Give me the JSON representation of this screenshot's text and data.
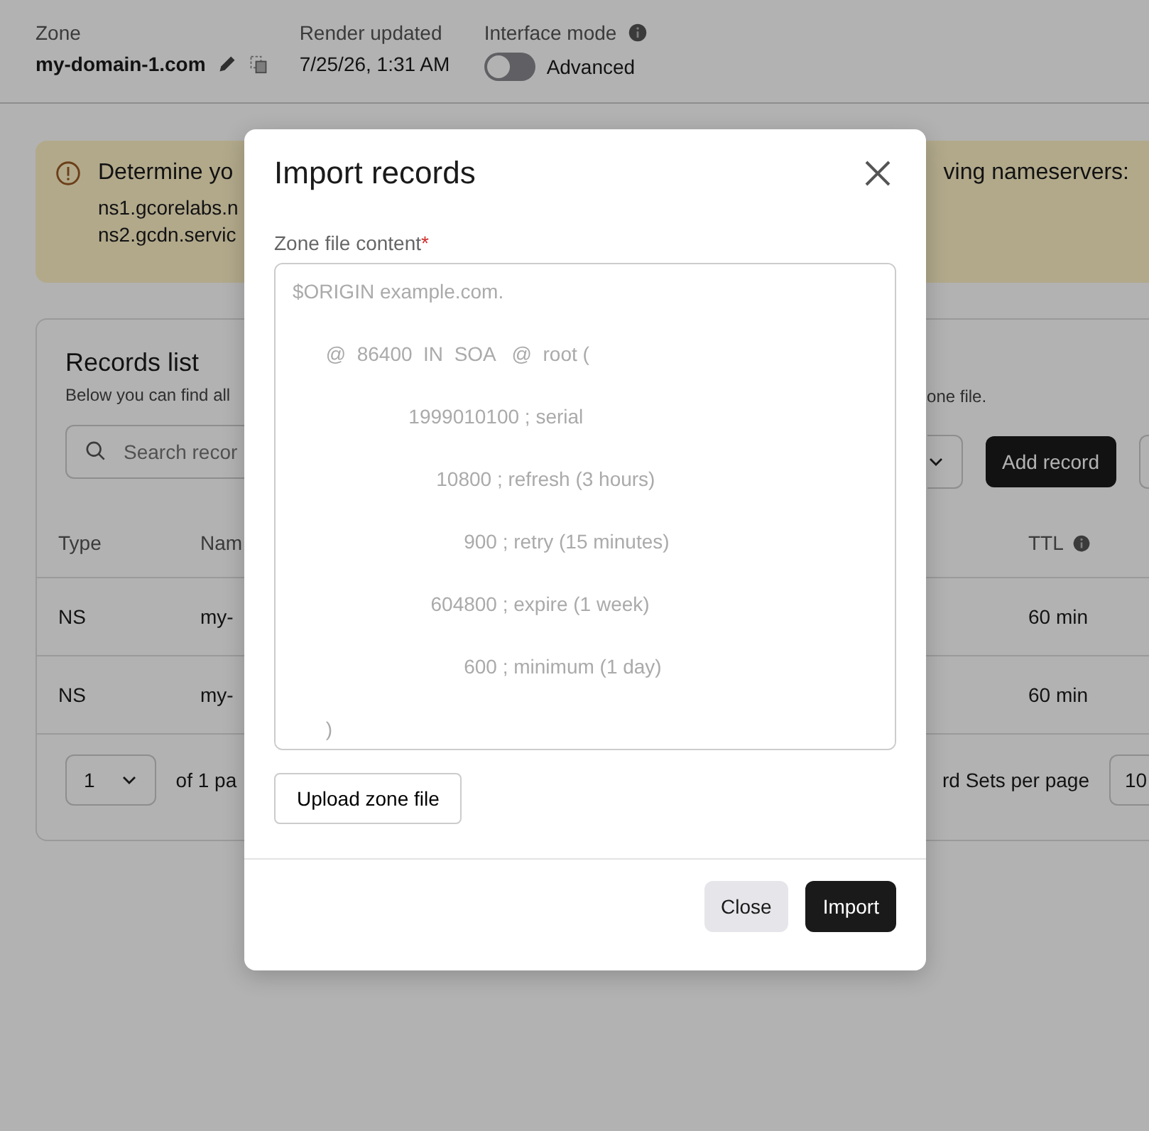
{
  "header": {
    "zone_label": "Zone",
    "zone": "my-domain-1.com",
    "render_label": "Render updated",
    "render_time": "7/25/26, 1:31 AM",
    "mode_label": "Interface mode",
    "mode_toggle": {
      "on": false,
      "text": "Advanced"
    }
  },
  "banner": {
    "left_text": "Determine yo",
    "right_text": "ving nameservers:",
    "nameservers": [
      "ns1.gcorelabs.n",
      "ns2.gcdn.servic"
    ]
  },
  "records": {
    "title": "Records list",
    "subtitle_left": "Below you can find all",
    "subtitle_right": "one file.",
    "search_placeholder": "Search recor",
    "add_button": "Add record",
    "columns": [
      {
        "left": "Type",
        "middle": "Nam",
        "right": "TTL"
      }
    ],
    "rows": [
      {
        "type": "NS",
        "name": "my-",
        "ttl": "60 min"
      },
      {
        "type": "NS",
        "name": "my-",
        "ttl": "60 min"
      }
    ],
    "page": "1",
    "page_of": "of 1 pa",
    "per_page_label": "rd Sets per page",
    "per_page": "10"
  },
  "modal": {
    "title": "Import records",
    "field_label": "Zone file content",
    "required_mark": "*",
    "placeholder": "$ORIGIN example.com.\n\n      @  86400  IN  SOA   @  root (\n\n                     1999010100 ; serial\n\n                          10800 ; refresh (3 hours)\n\n                               900 ; retry (15 minutes)\n\n                         604800 ; expire (1 week)\n\n                               600 ; minimum (1 day)\n\n      )",
    "upload_button": "Upload zone file",
    "buttons": [
      {
        "label": "Close",
        "kind": "secondary"
      },
      {
        "label": "Import",
        "kind": "primary"
      }
    ]
  }
}
